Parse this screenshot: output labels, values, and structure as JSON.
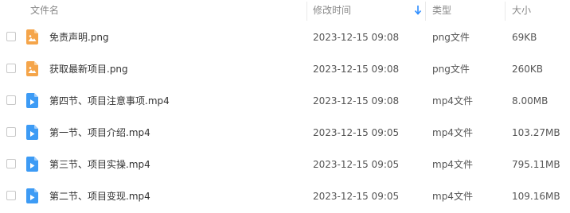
{
  "table": {
    "headers": {
      "name": "文件名",
      "modified": "修改时间",
      "type": "类型",
      "size": "大小"
    },
    "sort": {
      "column": "modified",
      "direction": "descending",
      "icon": "sort-down-arrow-icon",
      "color": "#2b8cff"
    },
    "rows": [
      {
        "name": "免责声明.png",
        "modified": "2023-12-15 09:08",
        "type": "png文件",
        "size": "69KB",
        "icon": "image-file-icon"
      },
      {
        "name": "获取最新项目.png",
        "modified": "2023-12-15 09:08",
        "type": "png文件",
        "size": "260KB",
        "icon": "image-file-icon"
      },
      {
        "name": "第四节、项目注意事项.mp4",
        "modified": "2023-12-15 09:08",
        "type": "mp4文件",
        "size": "8.00MB",
        "icon": "video-file-icon"
      },
      {
        "name": "第一节、项目介绍.mp4",
        "modified": "2023-12-15 09:05",
        "type": "mp4文件",
        "size": "103.27MB",
        "icon": "video-file-icon"
      },
      {
        "name": "第三节、项目实操.mp4",
        "modified": "2023-12-15 09:05",
        "type": "mp4文件",
        "size": "795.11MB",
        "icon": "video-file-icon"
      },
      {
        "name": "第二节、项目变现.mp4",
        "modified": "2023-12-15 09:05",
        "type": "mp4文件",
        "size": "109.16MB",
        "icon": "video-file-icon"
      }
    ]
  },
  "colors": {
    "image_icon": "#f5a54a",
    "video_icon": "#3d9bf5"
  }
}
